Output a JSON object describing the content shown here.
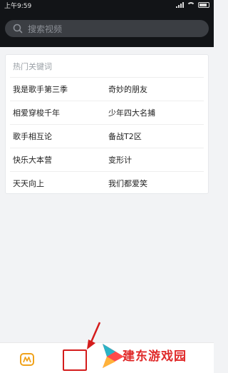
{
  "status": {
    "carrier_time": "上午9:59"
  },
  "search": {
    "placeholder": "搜索视频"
  },
  "hot": {
    "title": "热门关键词",
    "rows": [
      [
        "我是歌手第三季",
        "奇妙的朋友"
      ],
      [
        "相爱穿梭千年",
        "少年四大名捕"
      ],
      [
        "歌手相互论",
        "备战T2区"
      ],
      [
        "快乐大本营",
        "变形计"
      ],
      [
        "天天向上",
        "我们都爱笑"
      ]
    ]
  },
  "watermark": {
    "text": "建东游戏园"
  },
  "colors": {
    "topbar": "#121417",
    "accent": "#d41c1c",
    "brand": "#e02b2b"
  },
  "icons": {
    "app": "mango-tv-logo-icon",
    "arrow": "red-annotation-arrow"
  }
}
